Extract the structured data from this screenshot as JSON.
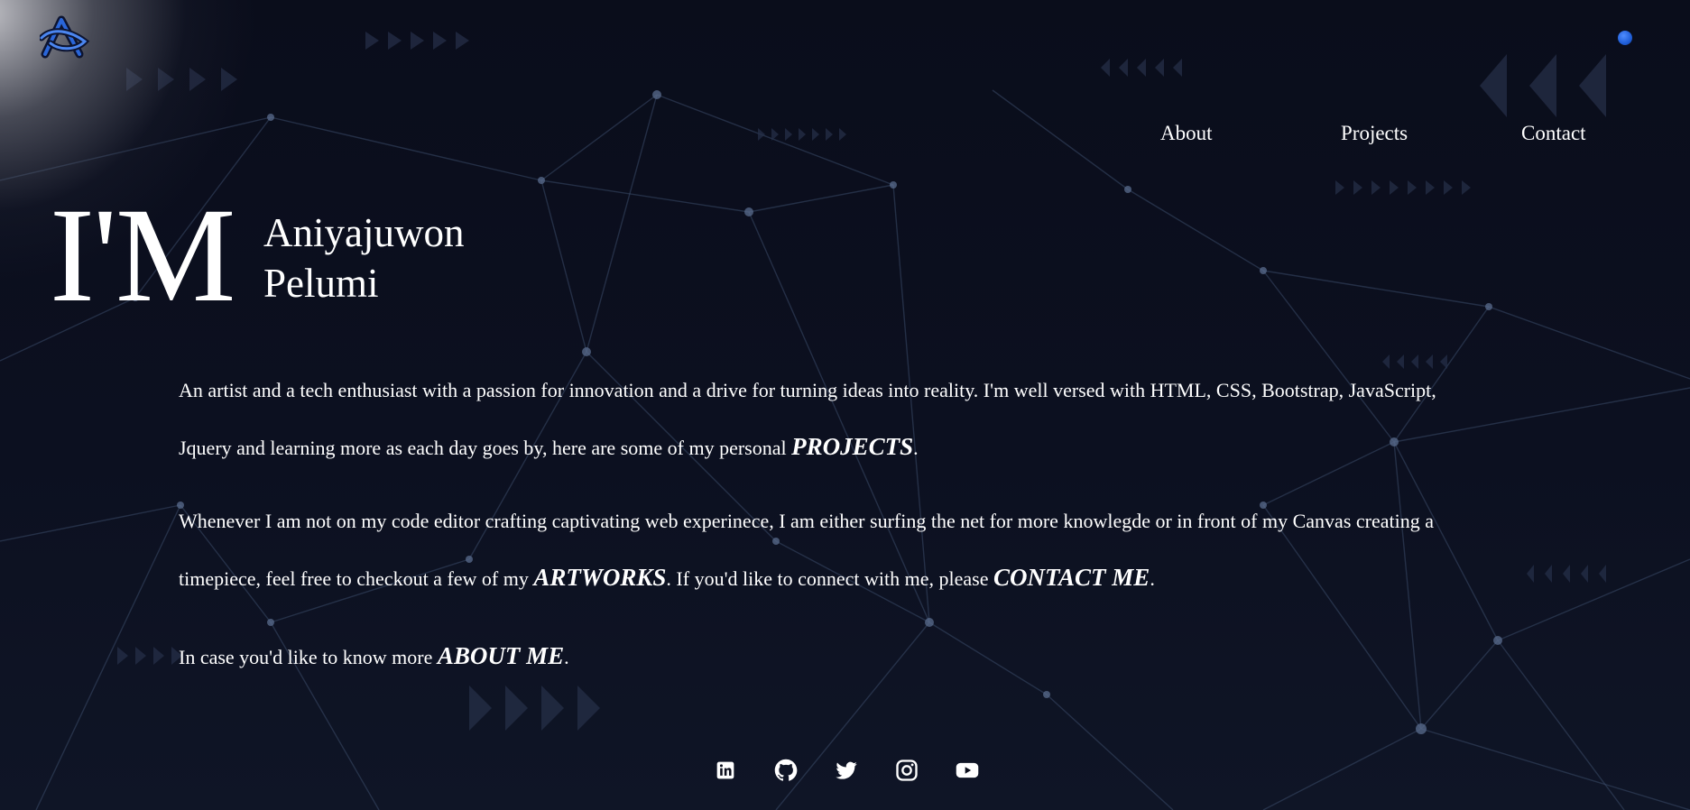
{
  "nav": {
    "about_label": "About",
    "projects_label": "Projects",
    "contact_label": "Contact"
  },
  "hero": {
    "prefix": "I'M",
    "first_name": "Aniyajuwon",
    "last_name": "Pelumi"
  },
  "bio": {
    "p1_text": "An artist and a tech enthusiast with a passion for innovation and a drive for turning ideas into reality. I'm well versed with HTML, CSS, Bootstrap, JavaScript, Jquery and learning more as each day goes by, here are some of my personal ",
    "p1_link": "PROJECTS",
    "p1_end": ".",
    "p2_text": "Whenever I am not on my code editor crafting captivating web experinece, I am either surfing the net for more knowlegde or in front of my Canvas creating a timepiece, feel free to checkout a few of my ",
    "p2_link1": "ARTWORKS",
    "p2_mid": ". If you'd like to connect with me, please ",
    "p2_link2": "CONTACT ME",
    "p2_end": ".",
    "p3_text": "In case you'd like to know more ",
    "p3_link": "ABOUT ME",
    "p3_end": "."
  },
  "socials": [
    {
      "icon": "linkedin-icon"
    },
    {
      "icon": "github-icon"
    },
    {
      "icon": "twitter-icon"
    },
    {
      "icon": "instagram-icon"
    },
    {
      "icon": "youtube-icon"
    }
  ],
  "colors": {
    "background": "#0b0e1c",
    "text": "#ffffff",
    "accent_dot": "#1f5ed8",
    "network_lines": "#3a4a66"
  }
}
